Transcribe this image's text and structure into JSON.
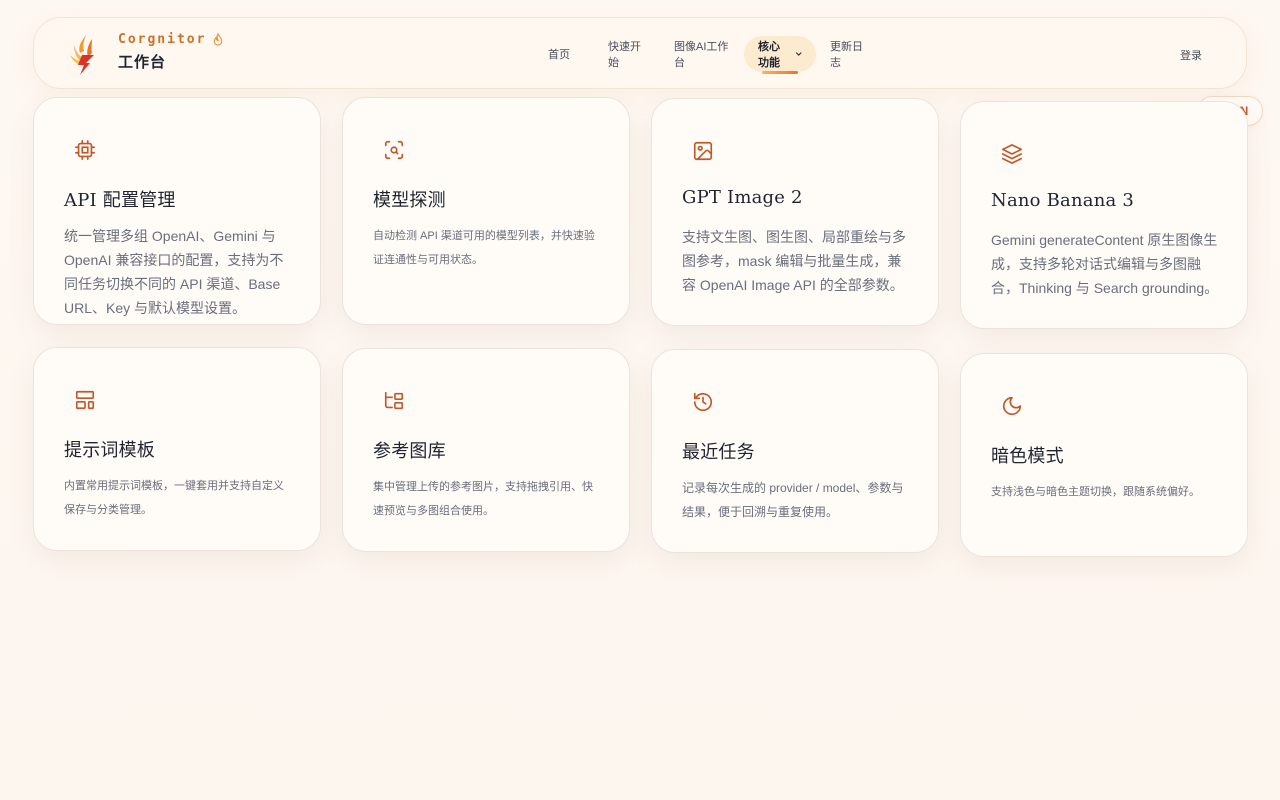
{
  "header": {
    "brand_name": "Corgnitor",
    "brand_subtitle": "工作台",
    "nav": [
      {
        "label": "首页"
      },
      {
        "label": "快速开始"
      },
      {
        "label": "图像AI工作台"
      },
      {
        "label": "核心功能"
      },
      {
        "label": "更新日志"
      }
    ],
    "right_link": "登录"
  },
  "lang_toggle": "EN",
  "cards": [
    {
      "title": "API 配置管理",
      "desc": "统一管理多组 OpenAI、Gemini 与 OpenAI 兼容接口的配置，支持为不同任务切换不同的 API 渠道、Base URL、Key 与默认模型设置。"
    },
    {
      "title": "模型探测",
      "desc": "自动检测 API 渠道可用的模型列表，并快速验证连通性与可用状态。"
    },
    {
      "title": "GPT Image 2",
      "desc": "支持文生图、图生图、局部重绘与多图参考，mask 编辑与批量生成，兼容 OpenAI Image API 的全部参数。"
    },
    {
      "title": "Nano Banana 3",
      "desc": "Gemini generateContent 原生图像生成，支持多轮对话式编辑与多图融合，Thinking 与 Search grounding。"
    },
    {
      "title": "提示词模板",
      "desc": "内置常用提示词模板，一键套用并支持自定义保存与分类管理。"
    },
    {
      "title": "参考图库",
      "desc": "集中管理上传的参考图片，支持拖拽引用、快速预览与多图组合使用。"
    },
    {
      "title": "最近任务",
      "desc": "记录每次生成的 provider / model、参数与结果，便于回溯与重复使用。"
    },
    {
      "title": "暗色模式",
      "desc": "支持浅色与暗色主题切换，跟随系统偏好。"
    }
  ],
  "colors": {
    "accent": "#c0592a",
    "active_tab_bg": "#fdebd0",
    "page_bg": "#fef8f2"
  },
  "icons": [
    "cpu-icon",
    "scan-search-icon",
    "image-icon",
    "layers-icon",
    "layout-template-icon",
    "folder-tree-icon",
    "history-icon",
    "moon-icon"
  ]
}
